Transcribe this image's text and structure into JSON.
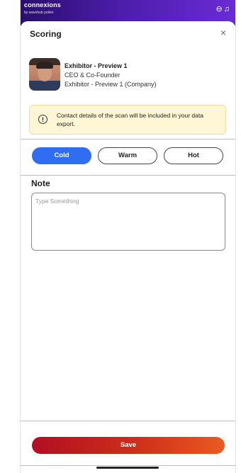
{
  "status_bar": {
    "brand": "connexions",
    "brand_sub": "by wavehub  pollen",
    "icons": [
      "chat-icon",
      "bell-icon"
    ]
  },
  "sheet": {
    "title": "Scoring",
    "close_label": "×"
  },
  "contact": {
    "name": "Exhibitor - Preview 1",
    "role": "CEO & Co-Founder",
    "company": "Exhibitor - Preview 1 (Company)"
  },
  "notice": {
    "icon_glyph": "!",
    "text": "Contact details of the scan will be included in your data export."
  },
  "temperature": {
    "options": [
      "Cold",
      "Warm",
      "Hot"
    ],
    "selected": "Cold",
    "selected_color": "#2f6ef2"
  },
  "note": {
    "label": "Note",
    "placeholder": "Type Something",
    "value": ""
  },
  "actions": {
    "save_label": "Save",
    "save_gradient": [
      "#b10f22",
      "#ea5b21"
    ]
  }
}
